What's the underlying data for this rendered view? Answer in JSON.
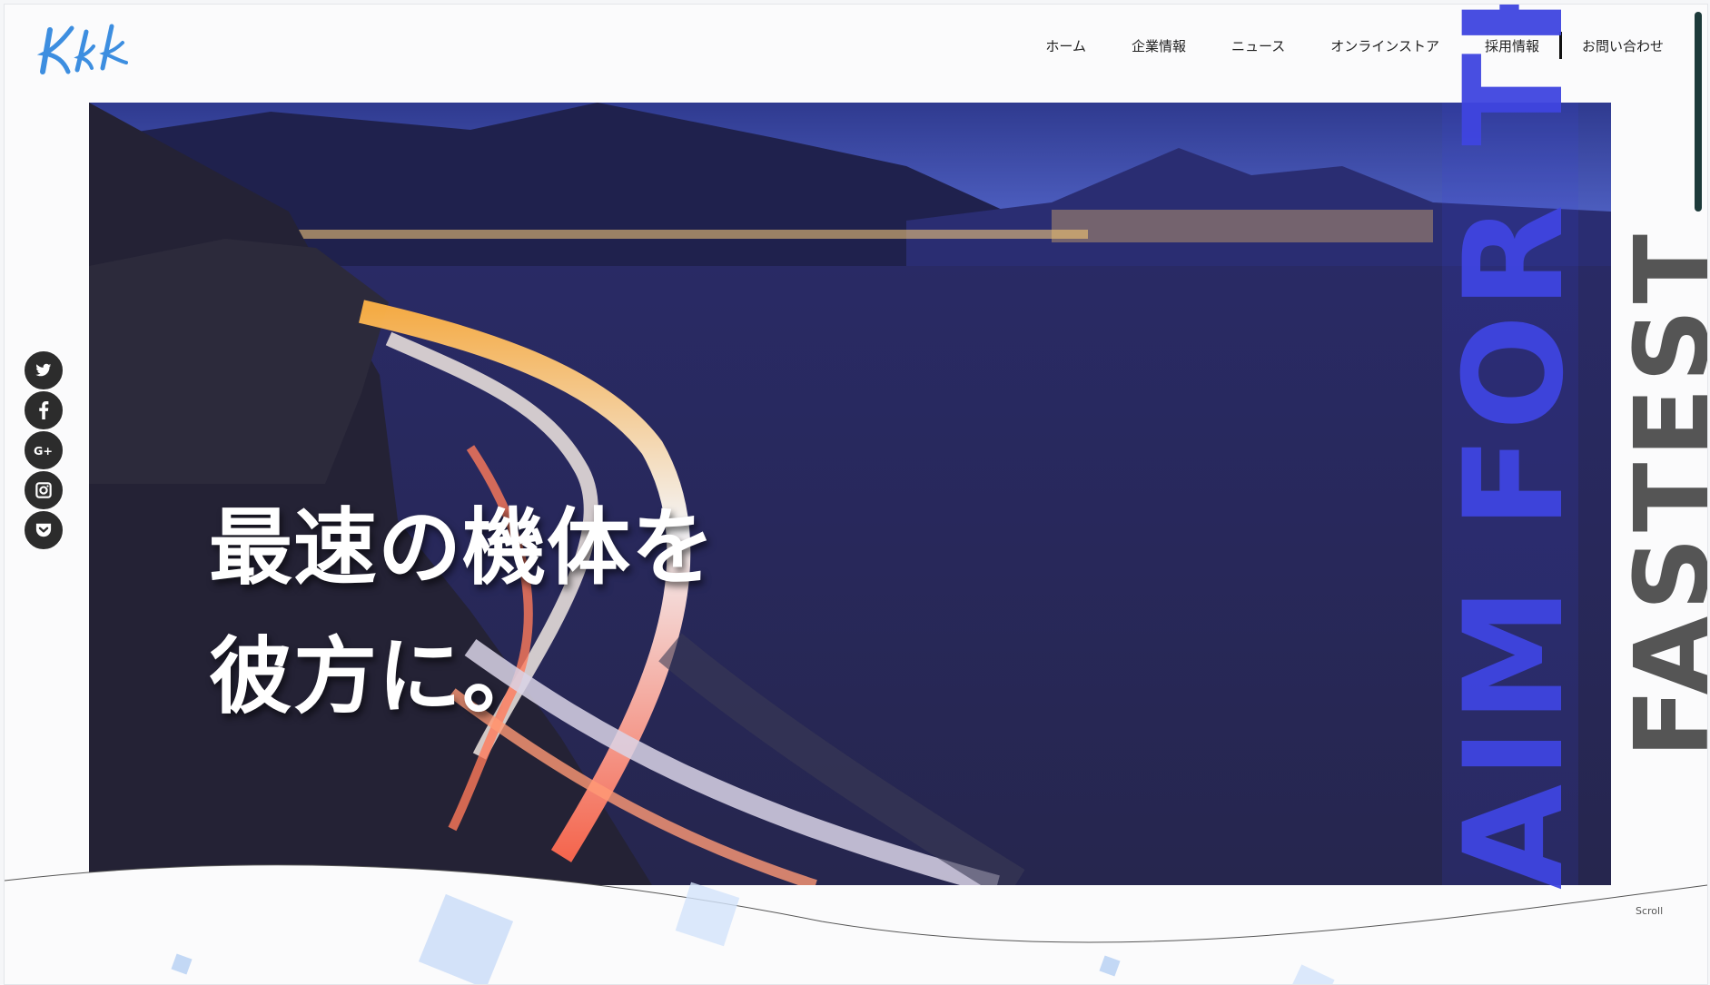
{
  "header": {
    "logo_text": "Kkk",
    "nav": [
      {
        "label": "ホーム"
      },
      {
        "label": "企業情報"
      },
      {
        "label": "ニュース"
      },
      {
        "label": "オンラインストア"
      },
      {
        "label": "採用情報"
      },
      {
        "label": "お問い合わせ"
      }
    ]
  },
  "hero": {
    "heading_line1": "最速の機体を",
    "heading_line2": "彼方に。",
    "slogan_vertical_1": "AIM FOR THE",
    "slogan_vertical_2": "FASTEST"
  },
  "social": [
    {
      "icon": "twitter-icon",
      "glyph": "🐦"
    },
    {
      "icon": "facebook-icon",
      "glyph": "f"
    },
    {
      "icon": "google-plus-icon",
      "glyph": "G+"
    },
    {
      "icon": "instagram-icon",
      "glyph": "◙"
    },
    {
      "icon": "pocket-icon",
      "glyph": "⌄"
    }
  ],
  "footer": {
    "scroll_label": "Scroll"
  },
  "colors": {
    "accent_red": "#d9434c",
    "slogan_blue": "#3f45e0",
    "logo_blue": "#3d8ee0",
    "scrollbar": "#1d3a3a"
  }
}
